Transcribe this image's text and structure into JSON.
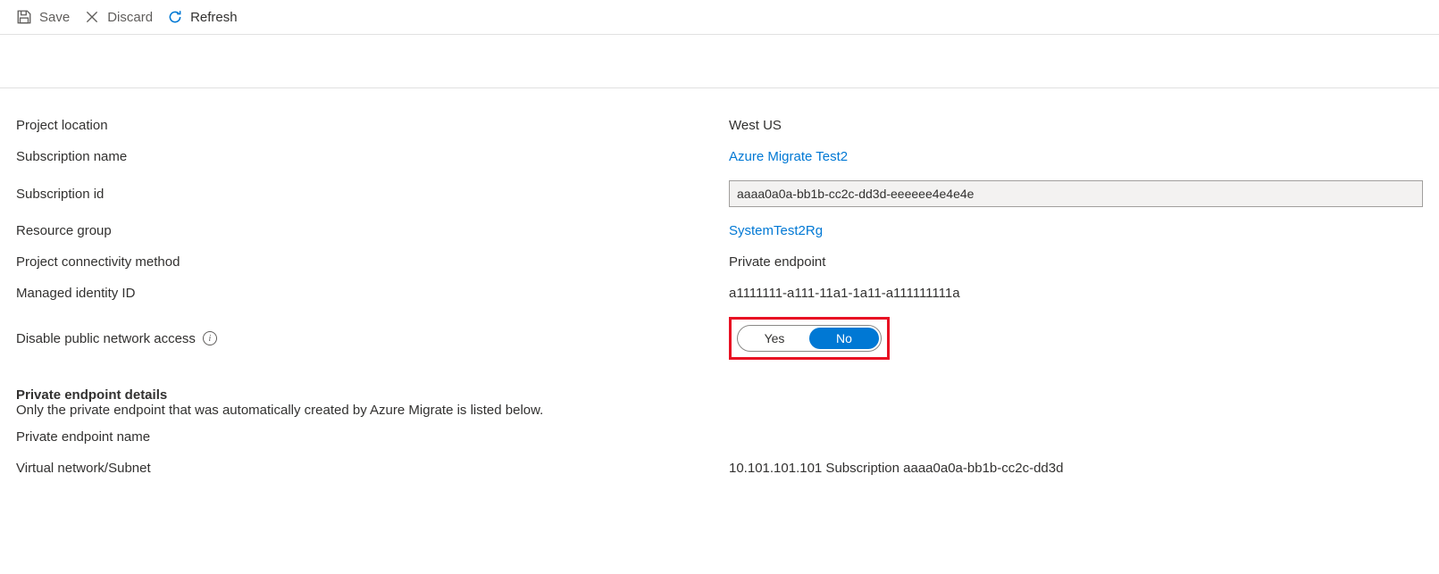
{
  "toolbar": {
    "save_label": "Save",
    "discard_label": "Discard",
    "refresh_label": "Refresh"
  },
  "properties": {
    "project_location": {
      "label": "Project location",
      "value": "West US"
    },
    "subscription_name": {
      "label": "Subscription name",
      "value": "Azure Migrate Test2"
    },
    "subscription_id": {
      "label": "Subscription id",
      "value": "aaaa0a0a-bb1b-cc2c-dd3d-eeeeee4e4e4e"
    },
    "resource_group": {
      "label": "Resource group",
      "value": "SystemTest2Rg"
    },
    "connectivity_method": {
      "label": "Project connectivity method",
      "value": "Private endpoint"
    },
    "managed_identity_id": {
      "label": "Managed identity ID",
      "value": "a1111111-a111-11a1-1a11-a111111111a"
    },
    "disable_public_access": {
      "label": "Disable public network access",
      "option_yes": "Yes",
      "option_no": "No"
    }
  },
  "private_endpoint": {
    "title": "Private endpoint details",
    "description": "Only the private endpoint that was automatically created by Azure Migrate is listed below.",
    "name_label": "Private endpoint name",
    "vnet_label": "Virtual network/Subnet",
    "vnet_value": "10.101.101.101 Subscription aaaa0a0a-bb1b-cc2c-dd3d"
  }
}
